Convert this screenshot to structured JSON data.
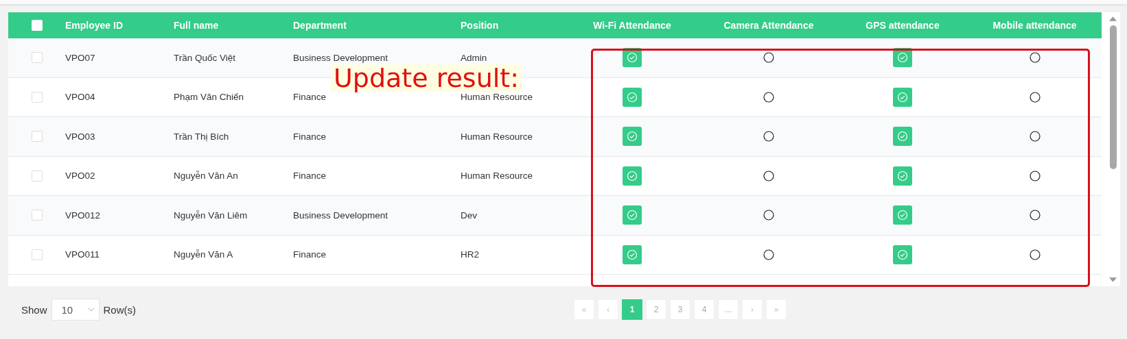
{
  "table": {
    "header_checkbox": {
      "checked": false
    },
    "columns": [
      "Employee ID",
      "Full name",
      "Department",
      "Position",
      "Wi-Fi Attendance",
      "Camera Attendance",
      "GPS attendance",
      "Mobile attendance"
    ],
    "rows": [
      {
        "checked": false,
        "employee_id": "VPO07",
        "full_name": "Trần Quốc Việt",
        "department": "Business Development",
        "position": "Admin",
        "wifi": true,
        "camera": false,
        "gps": true,
        "mobile": false
      },
      {
        "checked": false,
        "employee_id": "VPO04",
        "full_name": "Phạm Văn Chiến",
        "department": "Finance",
        "position": "Human Resource",
        "wifi": true,
        "camera": false,
        "gps": true,
        "mobile": false
      },
      {
        "checked": false,
        "employee_id": "VPO03",
        "full_name": "Trần Thị Bích",
        "department": "Finance",
        "position": "Human Resource",
        "wifi": true,
        "camera": false,
        "gps": true,
        "mobile": false
      },
      {
        "checked": false,
        "employee_id": "VPO02",
        "full_name": "Nguyễn Văn An",
        "department": "Finance",
        "position": "Human Resource",
        "wifi": true,
        "camera": false,
        "gps": true,
        "mobile": false
      },
      {
        "checked": false,
        "employee_id": "VPO012",
        "full_name": "Nguyễn Văn Liêm",
        "department": "Business Development",
        "position": "Dev",
        "wifi": true,
        "camera": false,
        "gps": true,
        "mobile": false
      },
      {
        "checked": false,
        "employee_id": "VPO011",
        "full_name": "Nguyễn Văn A",
        "department": "Finance",
        "position": "HR2",
        "wifi": true,
        "camera": false,
        "gps": true,
        "mobile": false
      }
    ]
  },
  "annotation": {
    "text": "Update result:"
  },
  "footer": {
    "show_label": "Show",
    "page_size": "10",
    "rows_label": "Row(s)",
    "pagination": [
      {
        "label": "«",
        "kind": "nav",
        "selected": false
      },
      {
        "label": "‹",
        "kind": "nav",
        "selected": false
      },
      {
        "label": "1",
        "kind": "page",
        "selected": true
      },
      {
        "label": "2",
        "kind": "page",
        "selected": false
      },
      {
        "label": "3",
        "kind": "page",
        "selected": false
      },
      {
        "label": "4",
        "kind": "page",
        "selected": false
      },
      {
        "label": "...",
        "kind": "page",
        "selected": false
      },
      {
        "label": "›",
        "kind": "nav",
        "selected": false
      },
      {
        "label": "»",
        "kind": "nav",
        "selected": false
      }
    ]
  }
}
